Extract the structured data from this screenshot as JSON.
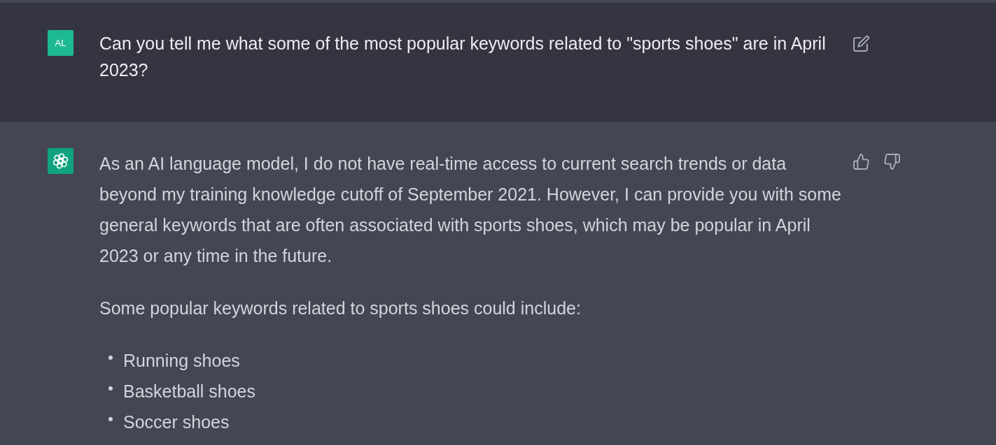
{
  "conversation": [
    {
      "kind": "user",
      "avatar": "AL",
      "blocks": [
        {
          "kind": "paragraph",
          "text": "Can you tell me what some of the most popular keywords related to \"sports shoes\" are in April 2023?"
        }
      ],
      "actions": [
        {
          "kind": "edit"
        }
      ]
    },
    {
      "kind": "assistant",
      "blocks": [
        {
          "kind": "paragraph",
          "text": "As an AI language model, I do not have real-time access to current search trends or data beyond my training knowledge cutoff of September 2021. However, I can provide you with some general keywords that are often associated with sports shoes, which may be popular in April 2023 or any time in the future."
        },
        {
          "kind": "paragraph",
          "text": "Some popular keywords related to sports shoes could include:"
        },
        {
          "kind": "list",
          "items": [
            "Running shoes",
            "Basketball shoes",
            "Soccer shoes"
          ]
        }
      ],
      "actions": [
        {
          "kind": "thumbs-up"
        },
        {
          "kind": "thumbs-down"
        }
      ]
    }
  ]
}
